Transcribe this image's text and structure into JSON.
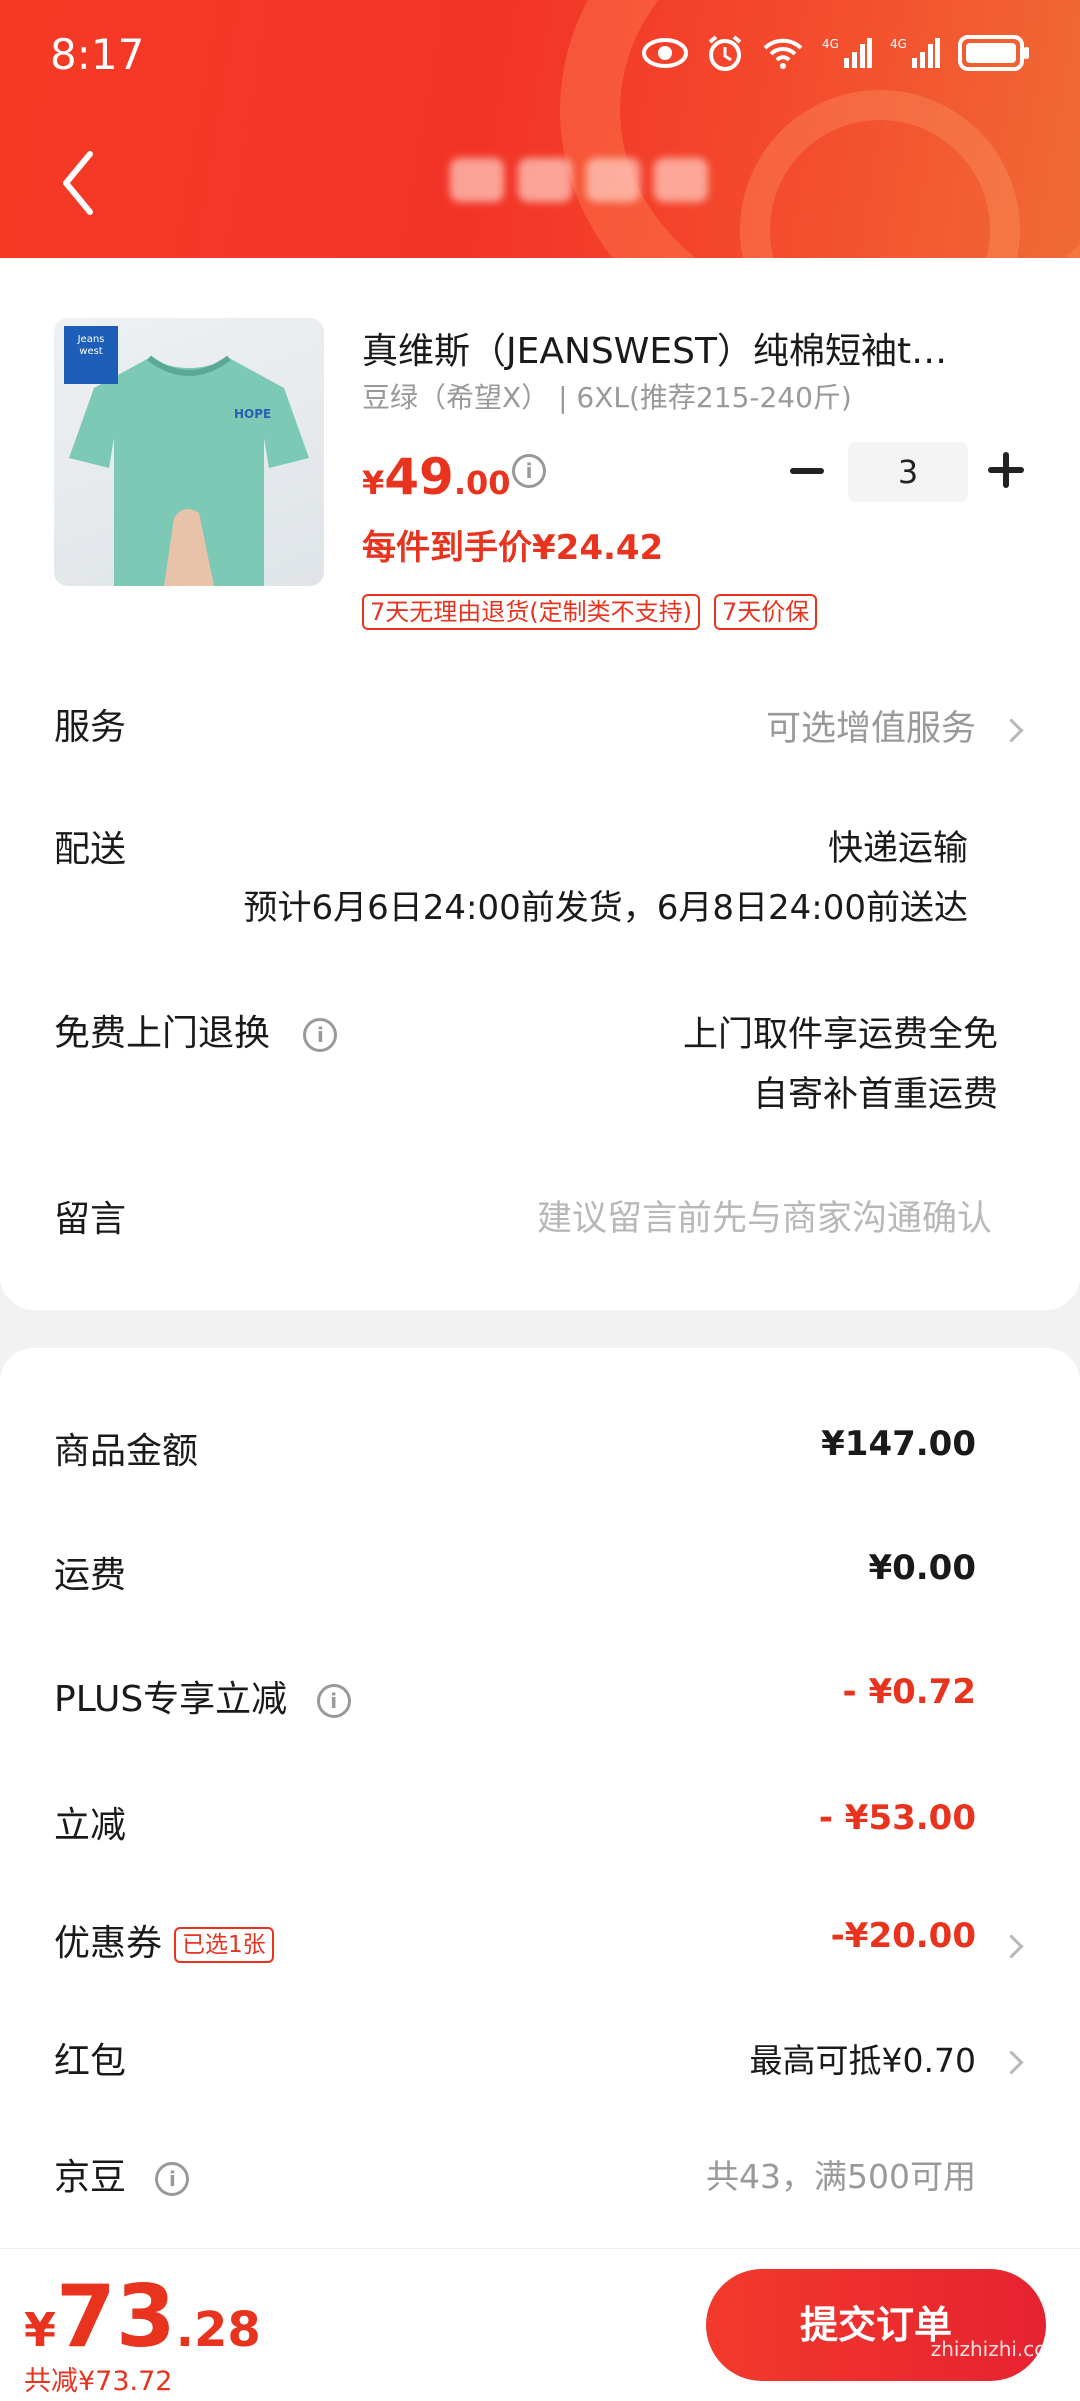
{
  "status_bar": {
    "time": "8:17"
  },
  "product": {
    "title": "真维斯（JEANSWEST）纯棉短袖t…",
    "spec": "豆绿（希望X） | 6XL(推荐215-240斤)",
    "brand_logo_text": "Jeans west 真维斯",
    "price_yen": "¥",
    "price_int": "49",
    "price_dec": ".00",
    "quantity": "3",
    "unit_price": "每件到手价¥24.42",
    "tags": [
      "7天无理由退货(定制类不支持)",
      "7天价保"
    ]
  },
  "rows": {
    "service": {
      "label": "服务",
      "value": "可选增值服务"
    },
    "delivery": {
      "label": "配送",
      "value": "快递运输",
      "detail": "预计6月6日24:00前发货，6月8日24:00前送达"
    },
    "return": {
      "label": "免费上门退换",
      "line1": "上门取件享运费全免",
      "line2": "自寄补首重运费"
    },
    "message": {
      "label": "留言",
      "placeholder": "建议留言前先与商家沟通确认"
    }
  },
  "costs": {
    "goods": {
      "label": "商品金额",
      "value": "¥147.00"
    },
    "shipping": {
      "label": "运费",
      "value": "¥0.00"
    },
    "plus": {
      "label": "PLUS专享立减",
      "value": "- ¥0.72"
    },
    "instant": {
      "label": "立减",
      "value": "- ¥53.00"
    },
    "coupon": {
      "label": "优惠券",
      "badge": "已选1张",
      "value": "-¥20.00"
    },
    "redpacket": {
      "label": "红包",
      "value": "最高可抵¥0.70"
    },
    "jingdou": {
      "label": "京豆",
      "value": "共43，满500可用"
    }
  },
  "bottom": {
    "total_yen": "¥",
    "total_int": "73",
    "total_dec": ".28",
    "saved": "共减¥73.72",
    "submit": "提交订单",
    "watermark": "zhizhizhi.com"
  },
  "colors": {
    "accent": "#e8331f",
    "header": "#f23a27"
  }
}
